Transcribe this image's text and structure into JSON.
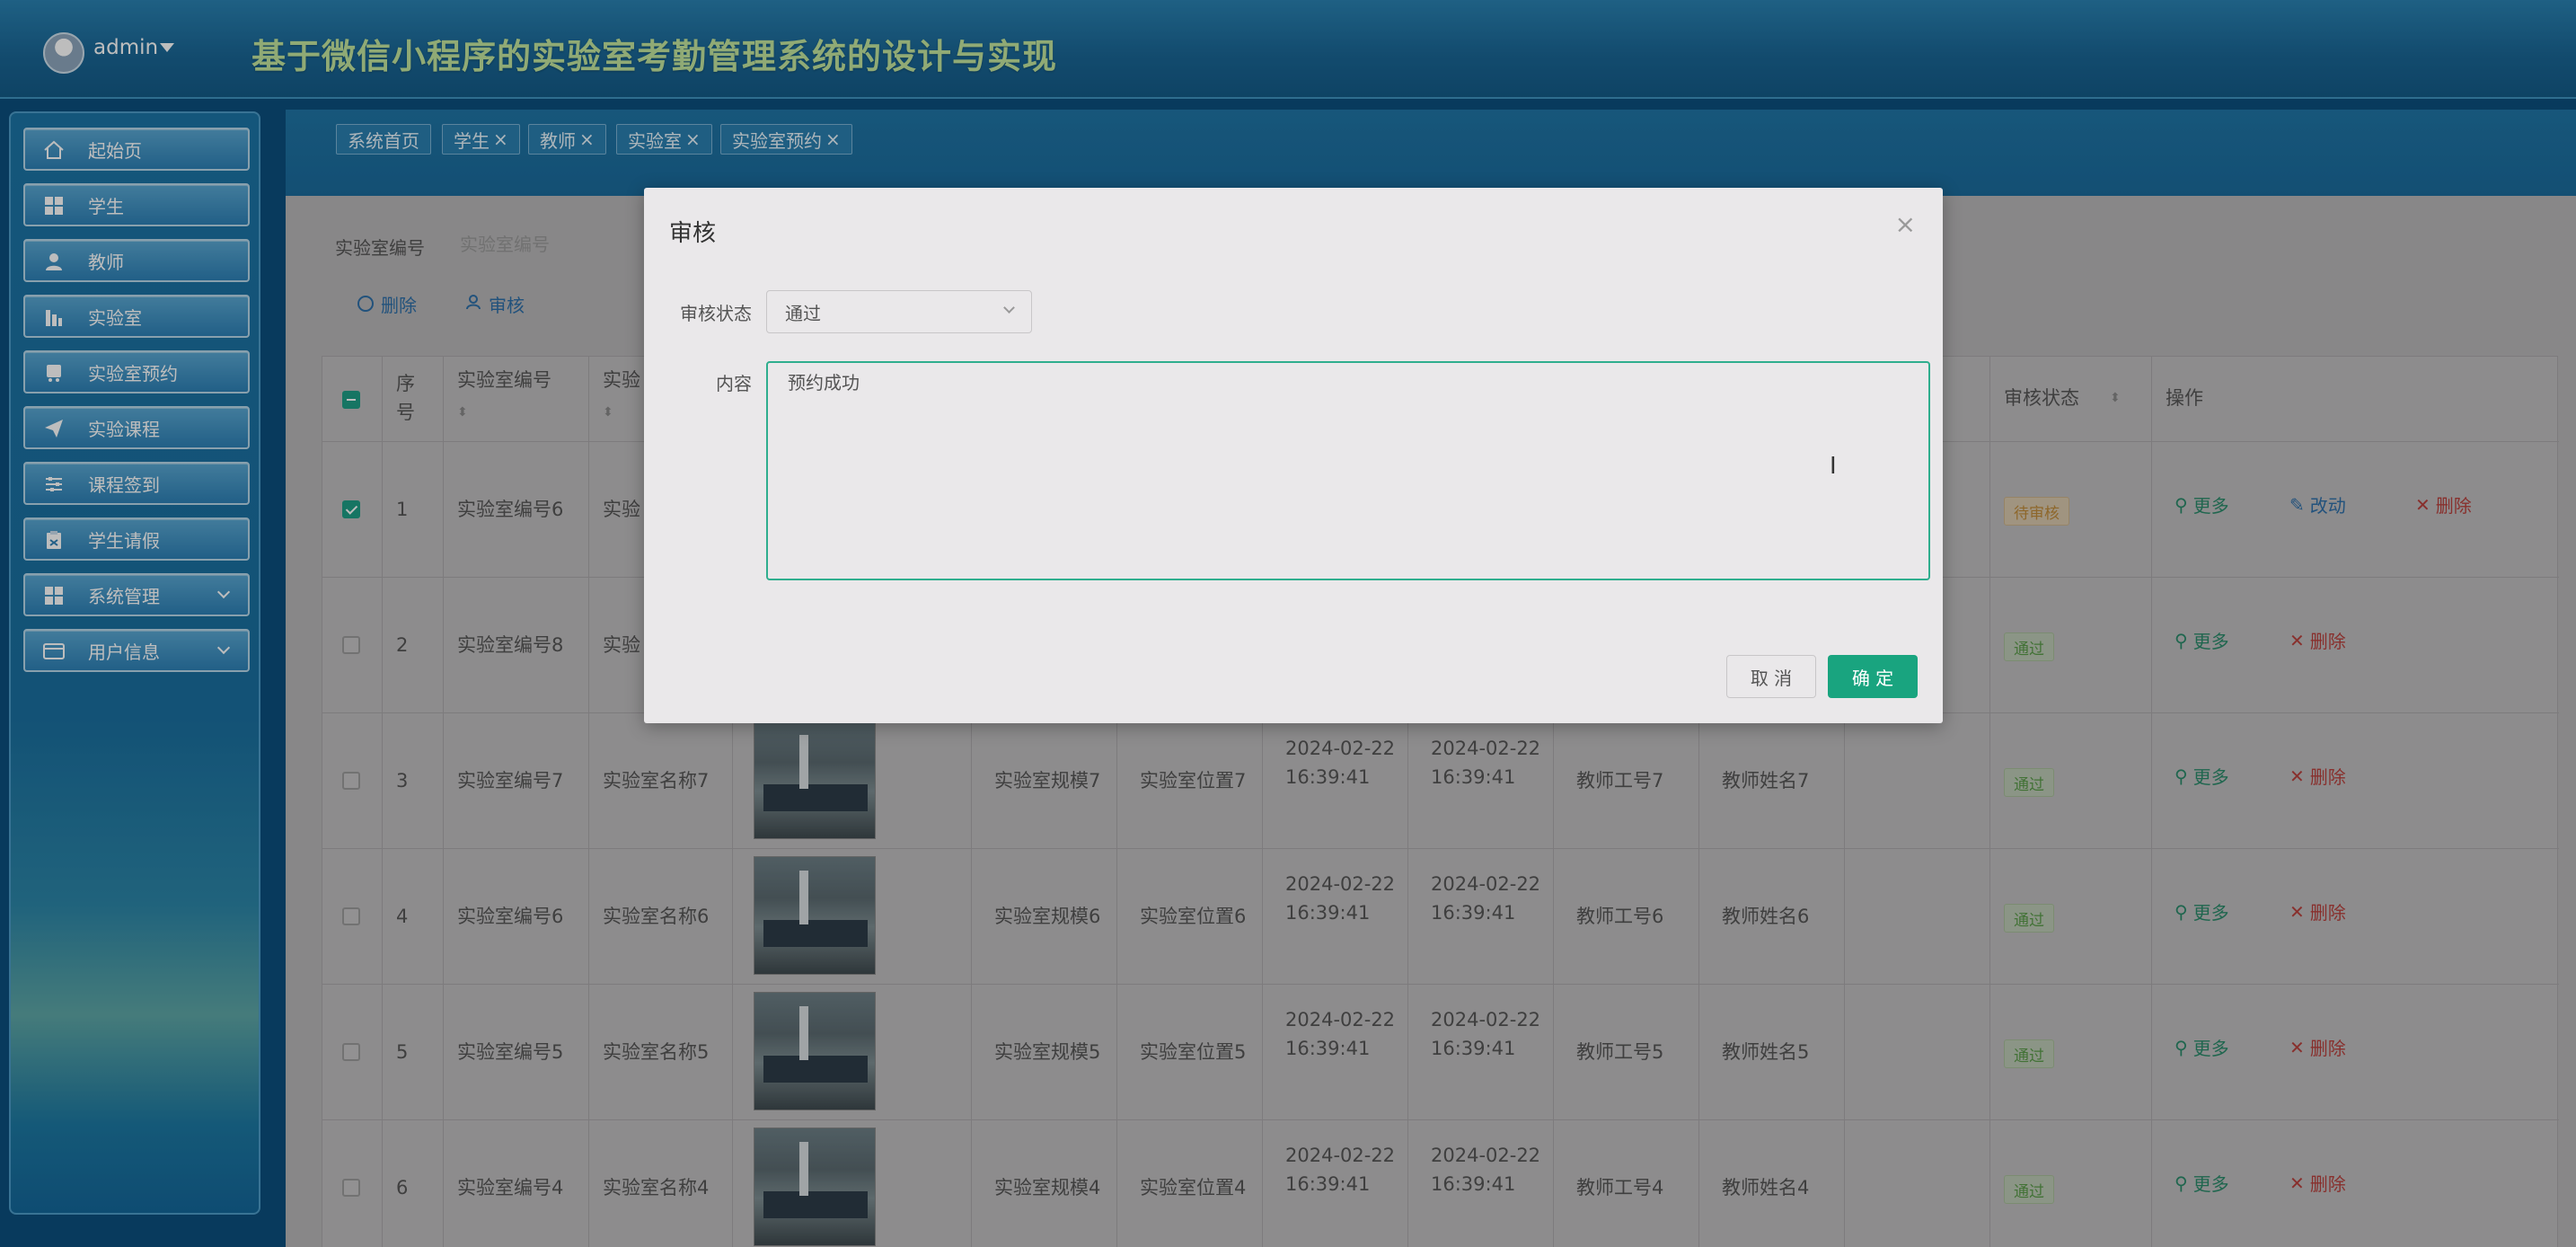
{
  "header": {
    "username": "admin",
    "system_title": "基于微信小程序的实验室考勤管理系统的设计与实现"
  },
  "sidebar": {
    "items": [
      {
        "label": "起始页",
        "icon": "home-icon"
      },
      {
        "label": "学生",
        "icon": "grid-icon"
      },
      {
        "label": "教师",
        "icon": "user-icon"
      },
      {
        "label": "实验室",
        "icon": "building-icon"
      },
      {
        "label": "实验室预约",
        "icon": "bus-icon"
      },
      {
        "label": "实验课程",
        "icon": "send-icon"
      },
      {
        "label": "课程签到",
        "icon": "sliders-icon"
      },
      {
        "label": "学生请假",
        "icon": "clipboard-icon"
      },
      {
        "label": "系统管理",
        "icon": "grid-icon"
      },
      {
        "label": "用户信息",
        "icon": "card-icon"
      }
    ]
  },
  "tabs": [
    {
      "label": "系统首页",
      "closable": false
    },
    {
      "label": "学生",
      "closable": true
    },
    {
      "label": "教师",
      "closable": true
    },
    {
      "label": "实验室",
      "closable": true
    },
    {
      "label": "实验室预约",
      "closable": true
    }
  ],
  "filter": {
    "label": "实验室编号",
    "placeholder": "实验室编号"
  },
  "toolbar": {
    "delete_label": "删除",
    "review_label": "审核"
  },
  "table": {
    "headers": {
      "index": "序号",
      "lab_no": "实验室编号",
      "lab_name_partial": "实验",
      "status": "审核状态",
      "ops": "操作"
    },
    "rows": [
      {
        "index": "1",
        "lab_no": "实验室编号6",
        "lab_name": "实验",
        "scale": "",
        "location": "",
        "t1": "",
        "t2": "",
        "teacher_no": "",
        "teacher_name": "",
        "status": "待审核",
        "checked": true,
        "has_image": false,
        "ops": [
          "更多",
          "改动",
          "删除"
        ]
      },
      {
        "index": "2",
        "lab_no": "实验室编号8",
        "lab_name": "实验",
        "scale": "",
        "location": "",
        "t1": "",
        "t2": "",
        "teacher_no": "",
        "teacher_name": "",
        "status": "通过",
        "checked": false,
        "has_image": false,
        "ops": [
          "更多",
          "删除"
        ]
      },
      {
        "index": "3",
        "lab_no": "实验室编号7",
        "lab_name": "实验室名称7",
        "scale": "实验室规模7",
        "location": "实验室位置7",
        "t1": "2024-02-22 16:39:41",
        "t2": "2024-02-22 16:39:41",
        "teacher_no": "教师工号7",
        "teacher_name": "教师姓名7",
        "status": "通过",
        "checked": false,
        "has_image": true,
        "ops": [
          "更多",
          "删除"
        ]
      },
      {
        "index": "4",
        "lab_no": "实验室编号6",
        "lab_name": "实验室名称6",
        "scale": "实验室规模6",
        "location": "实验室位置6",
        "t1": "2024-02-22 16:39:41",
        "t2": "2024-02-22 16:39:41",
        "teacher_no": "教师工号6",
        "teacher_name": "教师姓名6",
        "status": "通过",
        "checked": false,
        "has_image": true,
        "ops": [
          "更多",
          "删除"
        ]
      },
      {
        "index": "5",
        "lab_no": "实验室编号5",
        "lab_name": "实验室名称5",
        "scale": "实验室规模5",
        "location": "实验室位置5",
        "t1": "2024-02-22 16:39:41",
        "t2": "2024-02-22 16:39:41",
        "teacher_no": "教师工号5",
        "teacher_name": "教师姓名5",
        "status": "通过",
        "checked": false,
        "has_image": true,
        "ops": [
          "更多",
          "删除"
        ]
      },
      {
        "index": "6",
        "lab_no": "实验室编号4",
        "lab_name": "实验室名称4",
        "scale": "实验室规模4",
        "location": "实验室位置4",
        "t1": "2024-02-22 16:39:41",
        "t2": "2024-02-22 16:39:41",
        "teacher_no": "教师工号4",
        "teacher_name": "教师姓名4",
        "status": "通过",
        "checked": false,
        "has_image": true,
        "ops": [
          "更多",
          "删除"
        ]
      }
    ]
  },
  "dialog": {
    "title": "审核",
    "status_label": "审核状态",
    "status_value": "通过",
    "content_label": "内容",
    "content_value": "预约成功",
    "cancel_label": "取 消",
    "ok_label": "确 定"
  },
  "colors": {
    "accent": "#19a47f",
    "header_title": "#c3e69e",
    "delete": "#b8413d",
    "edit": "#2f6fa8"
  }
}
